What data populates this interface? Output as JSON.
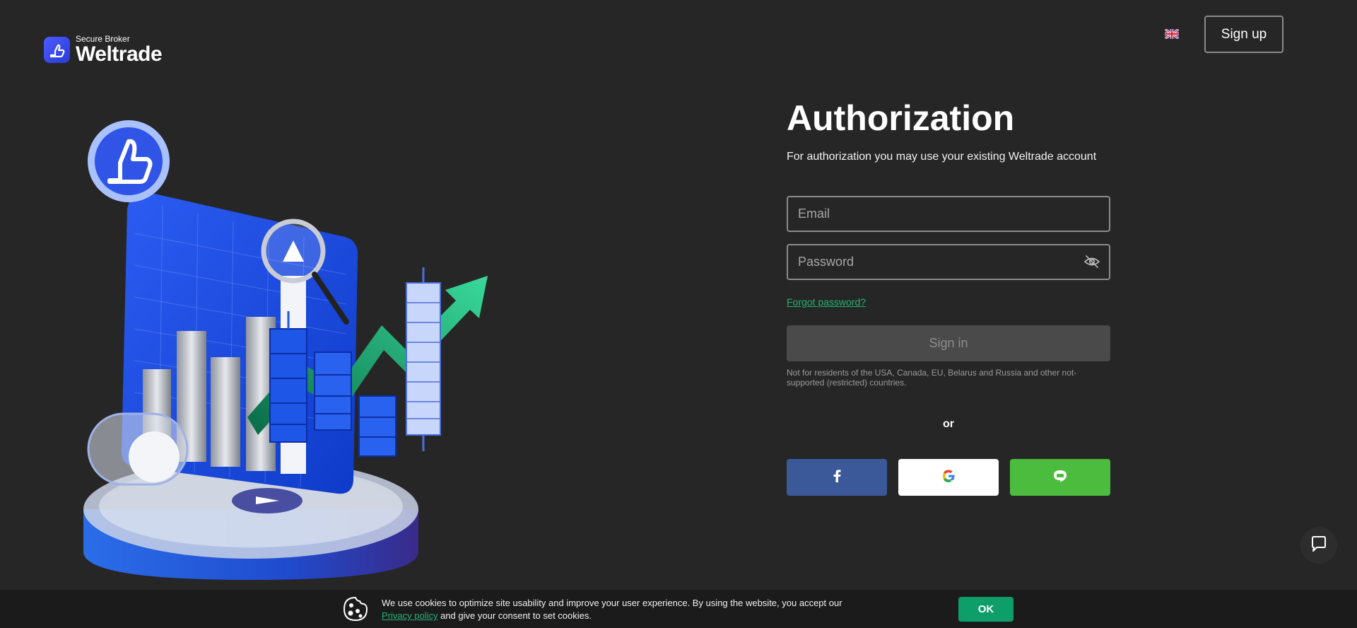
{
  "header": {
    "logo_sub": "Secure Broker",
    "logo_main": "Weltrade",
    "signup_label": "Sign up",
    "language": "English"
  },
  "form": {
    "title": "Authorization",
    "subtitle": "For authorization you may use your existing Weltrade account",
    "email_placeholder": "Email",
    "password_placeholder": "Password",
    "forgot_label": "Forgot password?",
    "signin_label": "Sign in",
    "disclaimer": "Not for residents of the USA, Canada, EU, Belarus and Russia and other not-supported (restricted) countries.",
    "or_label": "or"
  },
  "social": {
    "facebook_icon": "facebook-icon",
    "google_icon": "google-icon",
    "line_icon": "line-icon"
  },
  "cookie": {
    "text_1": "We use cookies to optimize site usability and improve your user experience. By using the website, you accept our",
    "link": "Privacy policy",
    "text_2": "and give your consent to set cookies.",
    "ok_label": "OK"
  },
  "colors": {
    "background": "#262626",
    "accent_green": "#1fb37a",
    "ok_green": "#0d9e6a",
    "facebook": "#3b5998",
    "line": "#4cbc3f",
    "brand_blue": "#3b4cf0"
  }
}
